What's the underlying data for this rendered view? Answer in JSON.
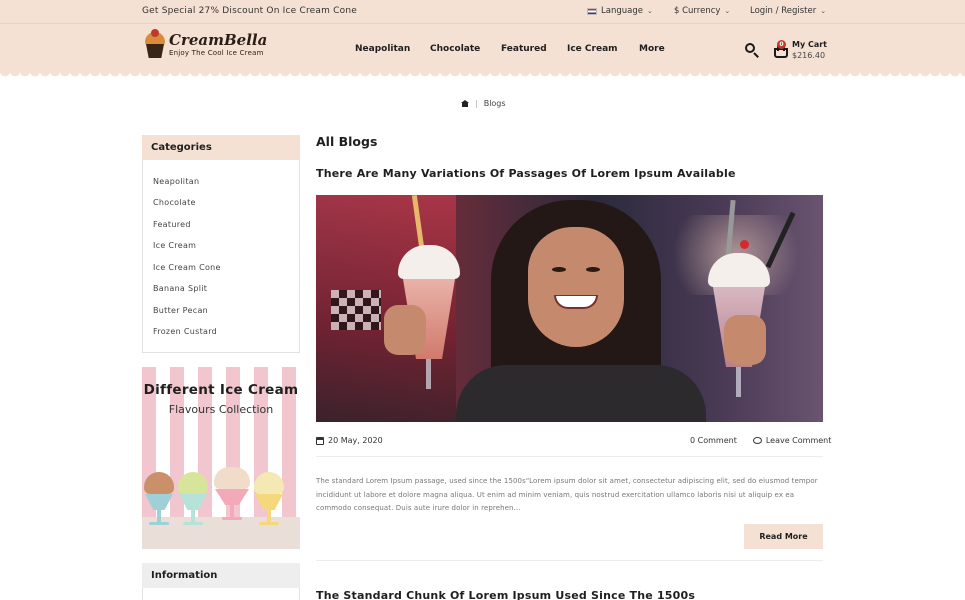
{
  "topbar": {
    "promo": "Get Special 27% Discount On Ice Cream Cone",
    "language": "Language",
    "currency": "$ Currency",
    "account": "Login / Register"
  },
  "header": {
    "brand": "CreamBella",
    "tagline": "Enjoy The Cool Ice Cream",
    "nav": [
      "Neapolitan",
      "Chocolate",
      "Featured",
      "Ice Cream",
      "More"
    ],
    "cart_label": "My Cart",
    "cart_total": "$216.40",
    "cart_count": "0"
  },
  "breadcrumb": {
    "current": "Blogs"
  },
  "sidebar": {
    "categories_title": "Categories",
    "categories": [
      "Neapolitan",
      "Chocolate",
      "Featured",
      "Ice Cream",
      "Ice Cream Cone",
      "Banana Split",
      "Butter Pecan",
      "Frozen Custard"
    ],
    "banner_title": "Different Ice Cream",
    "banner_subtitle": "Flavours Collection",
    "information_title": "Information"
  },
  "main": {
    "title": "All Blogs",
    "posts": [
      {
        "title": "There Are Many Variations Of Passages Of Lorem Ipsum Available",
        "date": "20 May, 2020",
        "comments": "0 Comment",
        "leave_comment": "Leave Comment",
        "excerpt": "The standard Lorem Ipsum passage, used since the 1500s\"Lorem ipsum dolor sit amet, consectetur adipiscing elit, sed do eiusmod tempor incididunt ut labore et dolore magna aliqua. Ut enim ad minim veniam, quis nostrud exercitation ullamco laboris nisi ut aliquip ex ea commodo consequat. Duis aute irure dolor in reprehen...",
        "read_more": "Read More"
      },
      {
        "title": "The Standard Chunk Of Lorem Ipsum Used Since The 1500s"
      }
    ]
  },
  "colors": {
    "accent": "#f5e1d3",
    "sidebar_info_bg": "#eeeeee",
    "badge": "#c0392b",
    "banner_stripe": "#f2c6cf"
  },
  "icons": [
    "flag-icon",
    "chevron-down-icon",
    "search-icon",
    "cart-icon",
    "home-icon",
    "calendar-icon",
    "comment-icon"
  ]
}
